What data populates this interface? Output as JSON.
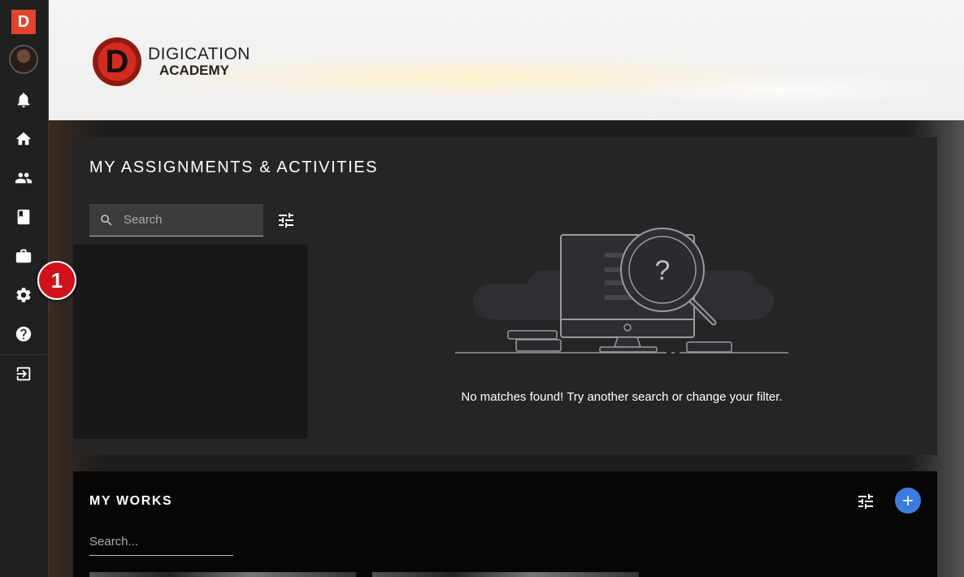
{
  "sidebar": {
    "logo_letter": "D",
    "icons": [
      "avatar",
      "bell-icon",
      "home-icon",
      "people-icon",
      "book-icon",
      "briefcase-icon",
      "gear-icon",
      "help-icon",
      "logout-icon"
    ]
  },
  "brand": {
    "letter": "D",
    "line1": "DIGICATION",
    "line2": "ACADEMY"
  },
  "assignments": {
    "title": "MY ASSIGNMENTS & ACTIVITIES",
    "search_placeholder": "Search",
    "empty_message": "No matches found! Try another search or change your filter."
  },
  "badge": {
    "label": "1"
  },
  "works": {
    "title": "MY WORKS",
    "search_placeholder": "Search..."
  },
  "colors": {
    "accent_blue": "#3b7ddd",
    "brand_red": "#e2432a",
    "badge_red": "#d0111b"
  }
}
